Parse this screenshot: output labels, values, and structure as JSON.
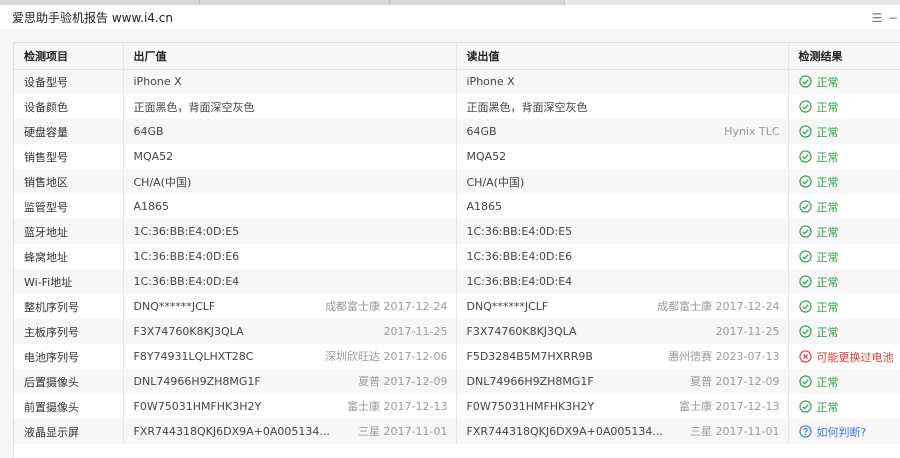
{
  "window": {
    "title": "爱思助手验机报告 www.i4.cn",
    "ctrl_menu_glyph": "☰",
    "ctrl_close_glyph": "−"
  },
  "table": {
    "headers": [
      "检测项目",
      "出厂值",
      "读出值",
      "检测结果"
    ],
    "rows": [
      {
        "item": "设备型号",
        "factory": "iPhone X",
        "factory_note": "",
        "read": "iPhone X",
        "read_note": "",
        "result": "正常",
        "status": "ok"
      },
      {
        "item": "设备颜色",
        "factory": "正面黑色，背面深空灰色",
        "factory_note": "",
        "read": "正面黑色，背面深空灰色",
        "read_note": "",
        "result": "正常",
        "status": "ok"
      },
      {
        "item": "硬盘容量",
        "factory": "64GB",
        "factory_note": "",
        "read": "64GB",
        "read_note": "Hynix TLC",
        "result": "正常",
        "status": "ok"
      },
      {
        "item": "销售型号",
        "factory": "MQA52",
        "factory_note": "",
        "read": "MQA52",
        "read_note": "",
        "result": "正常",
        "status": "ok"
      },
      {
        "item": "销售地区",
        "factory": "CH/A(中国)",
        "factory_note": "",
        "read": "CH/A(中国)",
        "read_note": "",
        "result": "正常",
        "status": "ok"
      },
      {
        "item": "监管型号",
        "factory": "A1865",
        "factory_note": "",
        "read": "A1865",
        "read_note": "",
        "result": "正常",
        "status": "ok"
      },
      {
        "item": "蓝牙地址",
        "factory": "1C:36:BB:E4:0D:E5",
        "factory_note": "",
        "read": "1C:36:BB:E4:0D:E5",
        "read_note": "",
        "result": "正常",
        "status": "ok"
      },
      {
        "item": "蜂窝地址",
        "factory": "1C:36:BB:E4:0D:E6",
        "factory_note": "",
        "read": "1C:36:BB:E4:0D:E6",
        "read_note": "",
        "result": "正常",
        "status": "ok"
      },
      {
        "item": "Wi-Fi地址",
        "factory": "1C:36:BB:E4:0D:E4",
        "factory_note": "",
        "read": "1C:36:BB:E4:0D:E4",
        "read_note": "",
        "result": "正常",
        "status": "ok"
      },
      {
        "item": "整机序列号",
        "factory": "DNQ******JCLF",
        "factory_note": "成都富士康 2017-12-24",
        "read": "DNQ******JCLF",
        "read_note": "成都富士康 2017-12-24",
        "result": "正常",
        "status": "ok"
      },
      {
        "item": "主板序列号",
        "factory": "F3X74760K8KJ3QLA",
        "factory_note": "2017-11-25",
        "read": "F3X74760K8KJ3QLA",
        "read_note": "2017-11-25",
        "result": "正常",
        "status": "ok"
      },
      {
        "item": "电池序列号",
        "factory": "F8Y74931LQLHXT28C",
        "factory_note": "深圳欣旺达 2017-12-06",
        "read": "F5D3284B5M7HXRR9B",
        "read_note": "惠州德赛 2023-07-13",
        "result": "可能更换过电池",
        "status": "warn"
      },
      {
        "item": "后置摄像头",
        "factory": "DNL74966H9ZH8MG1F",
        "factory_note": "夏普 2017-12-09",
        "read": "DNL74966H9ZH8MG1F",
        "read_note": "夏普 2017-12-09",
        "result": "正常",
        "status": "ok"
      },
      {
        "item": "前置摄像头",
        "factory": "F0W75031HMFHK3H2Y",
        "factory_note": "富士康 2017-12-13",
        "read": "F0W75031HMFHK3H2Y",
        "read_note": "富士康 2017-12-13",
        "result": "正常",
        "status": "ok"
      },
      {
        "item": "液晶显示屏",
        "factory": "FXR744318QKJ6DX9A+0A005134...",
        "factory_note": "三星 2017-11-01",
        "read": "FXR744318QKJ6DX9A+0A005134...",
        "read_note": "三星 2017-11-01",
        "result": "如何判断?",
        "status": "help"
      }
    ]
  },
  "colors": {
    "ok": "#2e9d4c",
    "warn": "#e23a3a",
    "help": "#3b7bd8",
    "row_alt": "#f7f7f7"
  },
  "icons": {
    "ok": "check-circle-icon",
    "warn": "x-circle-icon",
    "help": "question-circle-icon"
  }
}
